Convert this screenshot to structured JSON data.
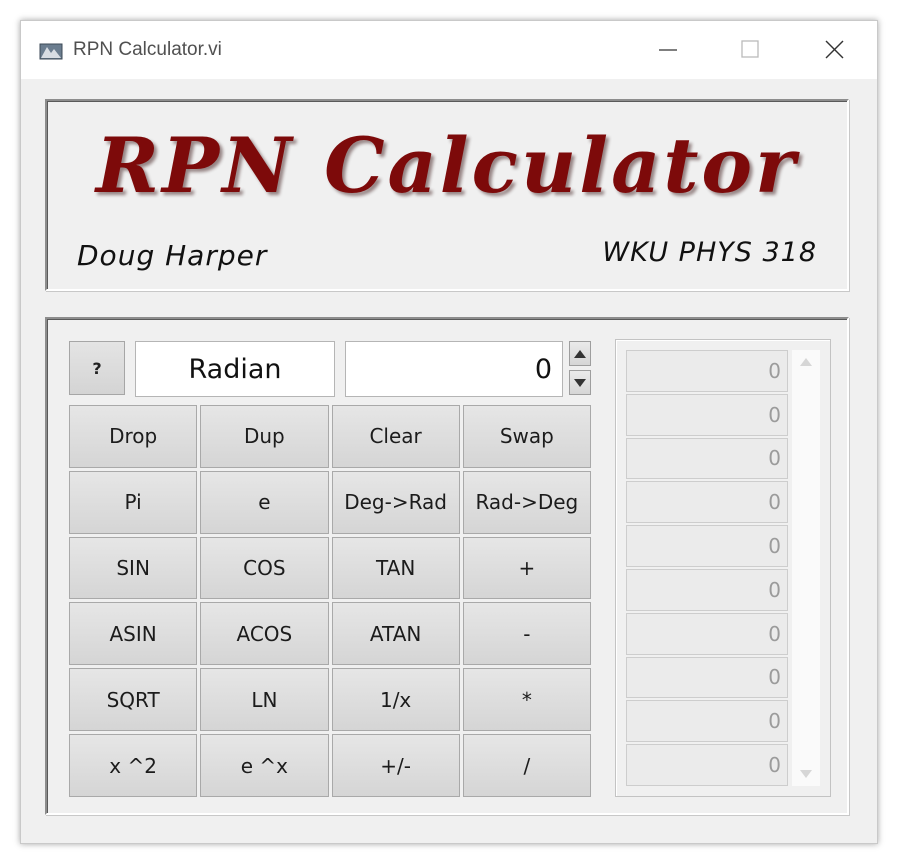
{
  "window": {
    "title": "RPN Calculator.vi"
  },
  "banner": {
    "title": "RPN Calculator",
    "author": "Doug Harper",
    "course": "WKU PHYS 318"
  },
  "controls": {
    "help_label": "?",
    "mode": "Radian",
    "entry_value": "0"
  },
  "keypad": {
    "keys": [
      "Drop",
      "Dup",
      "Clear",
      "Swap",
      "Pi",
      "e",
      "Deg->Rad",
      "Rad->Deg",
      "SIN",
      "COS",
      "TAN",
      "+",
      "ASIN",
      "ACOS",
      "ATAN",
      "-",
      "SQRT",
      "LN",
      "1/x",
      "*",
      "x ^2",
      "e ^x",
      "+/-",
      "/"
    ]
  },
  "stack": {
    "values": [
      "0",
      "0",
      "0",
      "0",
      "0",
      "0",
      "0",
      "0",
      "0",
      "0"
    ]
  },
  "colors": {
    "banner_title": "#7d0a0a",
    "window_bg": "#f0f0f0",
    "stack_text": "#9b9b9b"
  }
}
